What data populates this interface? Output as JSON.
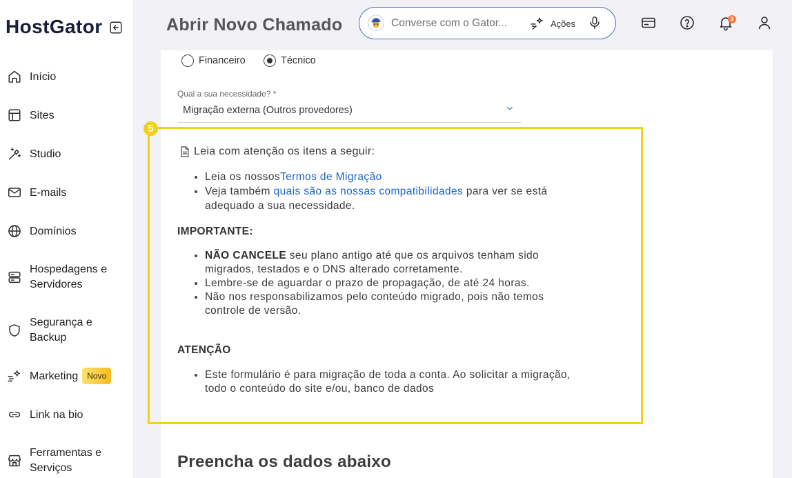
{
  "brand": {
    "logo": "HostGator"
  },
  "sidebar": {
    "items": [
      {
        "label": "Início",
        "icon": "home-icon"
      },
      {
        "label": "Sites",
        "icon": "layout-icon"
      },
      {
        "label": "Studio",
        "icon": "magic-wand-icon"
      },
      {
        "label": "E-mails",
        "icon": "envelope-icon"
      },
      {
        "label": "Domínios",
        "icon": "globe-icon"
      },
      {
        "label": "Hospedagens e Servidores",
        "icon": "server-icon"
      },
      {
        "label": "Segurança e Backup",
        "icon": "shield-icon"
      },
      {
        "label": "Marketing",
        "icon": "sparkle-icon",
        "badge": "Novo"
      },
      {
        "label": "Link na bio",
        "icon": "link-icon"
      },
      {
        "label": "Ferramentas e Serviços",
        "icon": "store-icon"
      }
    ]
  },
  "header": {
    "title": "Abrir Novo Chamado",
    "search": {
      "placeholder": "Converse com o Gator...",
      "actions_label": "Ações"
    },
    "notifications_count": "3"
  },
  "form": {
    "department_options": [
      {
        "label": "Financeiro",
        "selected": false
      },
      {
        "label": "Técnico",
        "selected": true
      }
    ],
    "need": {
      "label": "Qual a sua necessidade? *",
      "value": "Migração externa (Outros provedores)"
    }
  },
  "annotation": {
    "step_number": "5"
  },
  "notice": {
    "intro": "Leia com atenção os itens a seguir:",
    "intro_items": [
      {
        "before": "Leia os nossos",
        "link": "Termos de Migração"
      },
      {
        "before": "Veja também ",
        "link": "quais são as nossas compatibilidades",
        "after": " para ver se está adequado a sua necessidade."
      }
    ],
    "important_heading": "IMPORTANTE:",
    "important_items": [
      {
        "strong": "NÃO CANCELE",
        "text": " seu plano antigo até que os arquivos tenham sido migrados, testados e o DNS alterado corretamente."
      },
      {
        "text": "Lembre-se de aguardar o prazo de propagação, de até 24 horas."
      },
      {
        "text": "Não nos responsabilizamos pelo conteúdo migrado, pois não temos controle de versão."
      }
    ],
    "attention_heading": "ATENÇÃO",
    "attention_items": [
      {
        "text": "Este formulário é para migração de toda a conta. Ao solicitar a migração, todo o conteúdo do site e/ou, banco de dados"
      }
    ]
  },
  "section_title": "Preencha os dados abaixo",
  "colors": {
    "accent": "#1a63c6",
    "highlight": "#f3d116",
    "notification": "#f5793b",
    "brand": "#1b1f3b",
    "search_border": "#4d6cc9"
  }
}
